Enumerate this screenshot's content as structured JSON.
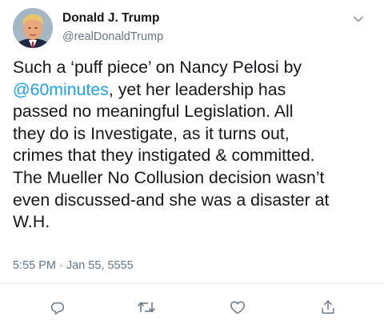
{
  "author": {
    "display_name": "Donald J. Trump",
    "handle": "@realDonaldTrump",
    "avatar_icon": "profile-photo"
  },
  "tweet": {
    "lines": [
      {
        "before": "Such a ‘puff piece’ on Nancy Pelosi by",
        "mention": "",
        "after": ""
      },
      {
        "before": "",
        "mention": "@60minutes",
        "after": ", yet her leadership has"
      },
      {
        "before": "passed no meaningful Legislation. All",
        "mention": "",
        "after": ""
      },
      {
        "before": "they do is Investigate, as it turns out,",
        "mention": "",
        "after": ""
      },
      {
        "before": "crimes that they instigated & committed.",
        "mention": "",
        "after": ""
      },
      {
        "before": "The Mueller No Collusion decision wasn’t",
        "mention": "",
        "after": ""
      },
      {
        "before": "even discussed-and she was a disaster at",
        "mention": "",
        "after": ""
      },
      {
        "before": "W.H.",
        "mention": "",
        "after": ""
      }
    ],
    "timestamp": "5:55 PM · Jan 55, 5555"
  },
  "actions": {
    "reply_icon": "reply-icon",
    "retweet_icon": "retweet-icon",
    "like_icon": "heart-icon",
    "share_icon": "share-icon"
  },
  "colors": {
    "text": "#14171a",
    "secondary": "#657786",
    "link": "#1da1f2",
    "icon": "#657786",
    "divider": "#e6ecf0"
  }
}
